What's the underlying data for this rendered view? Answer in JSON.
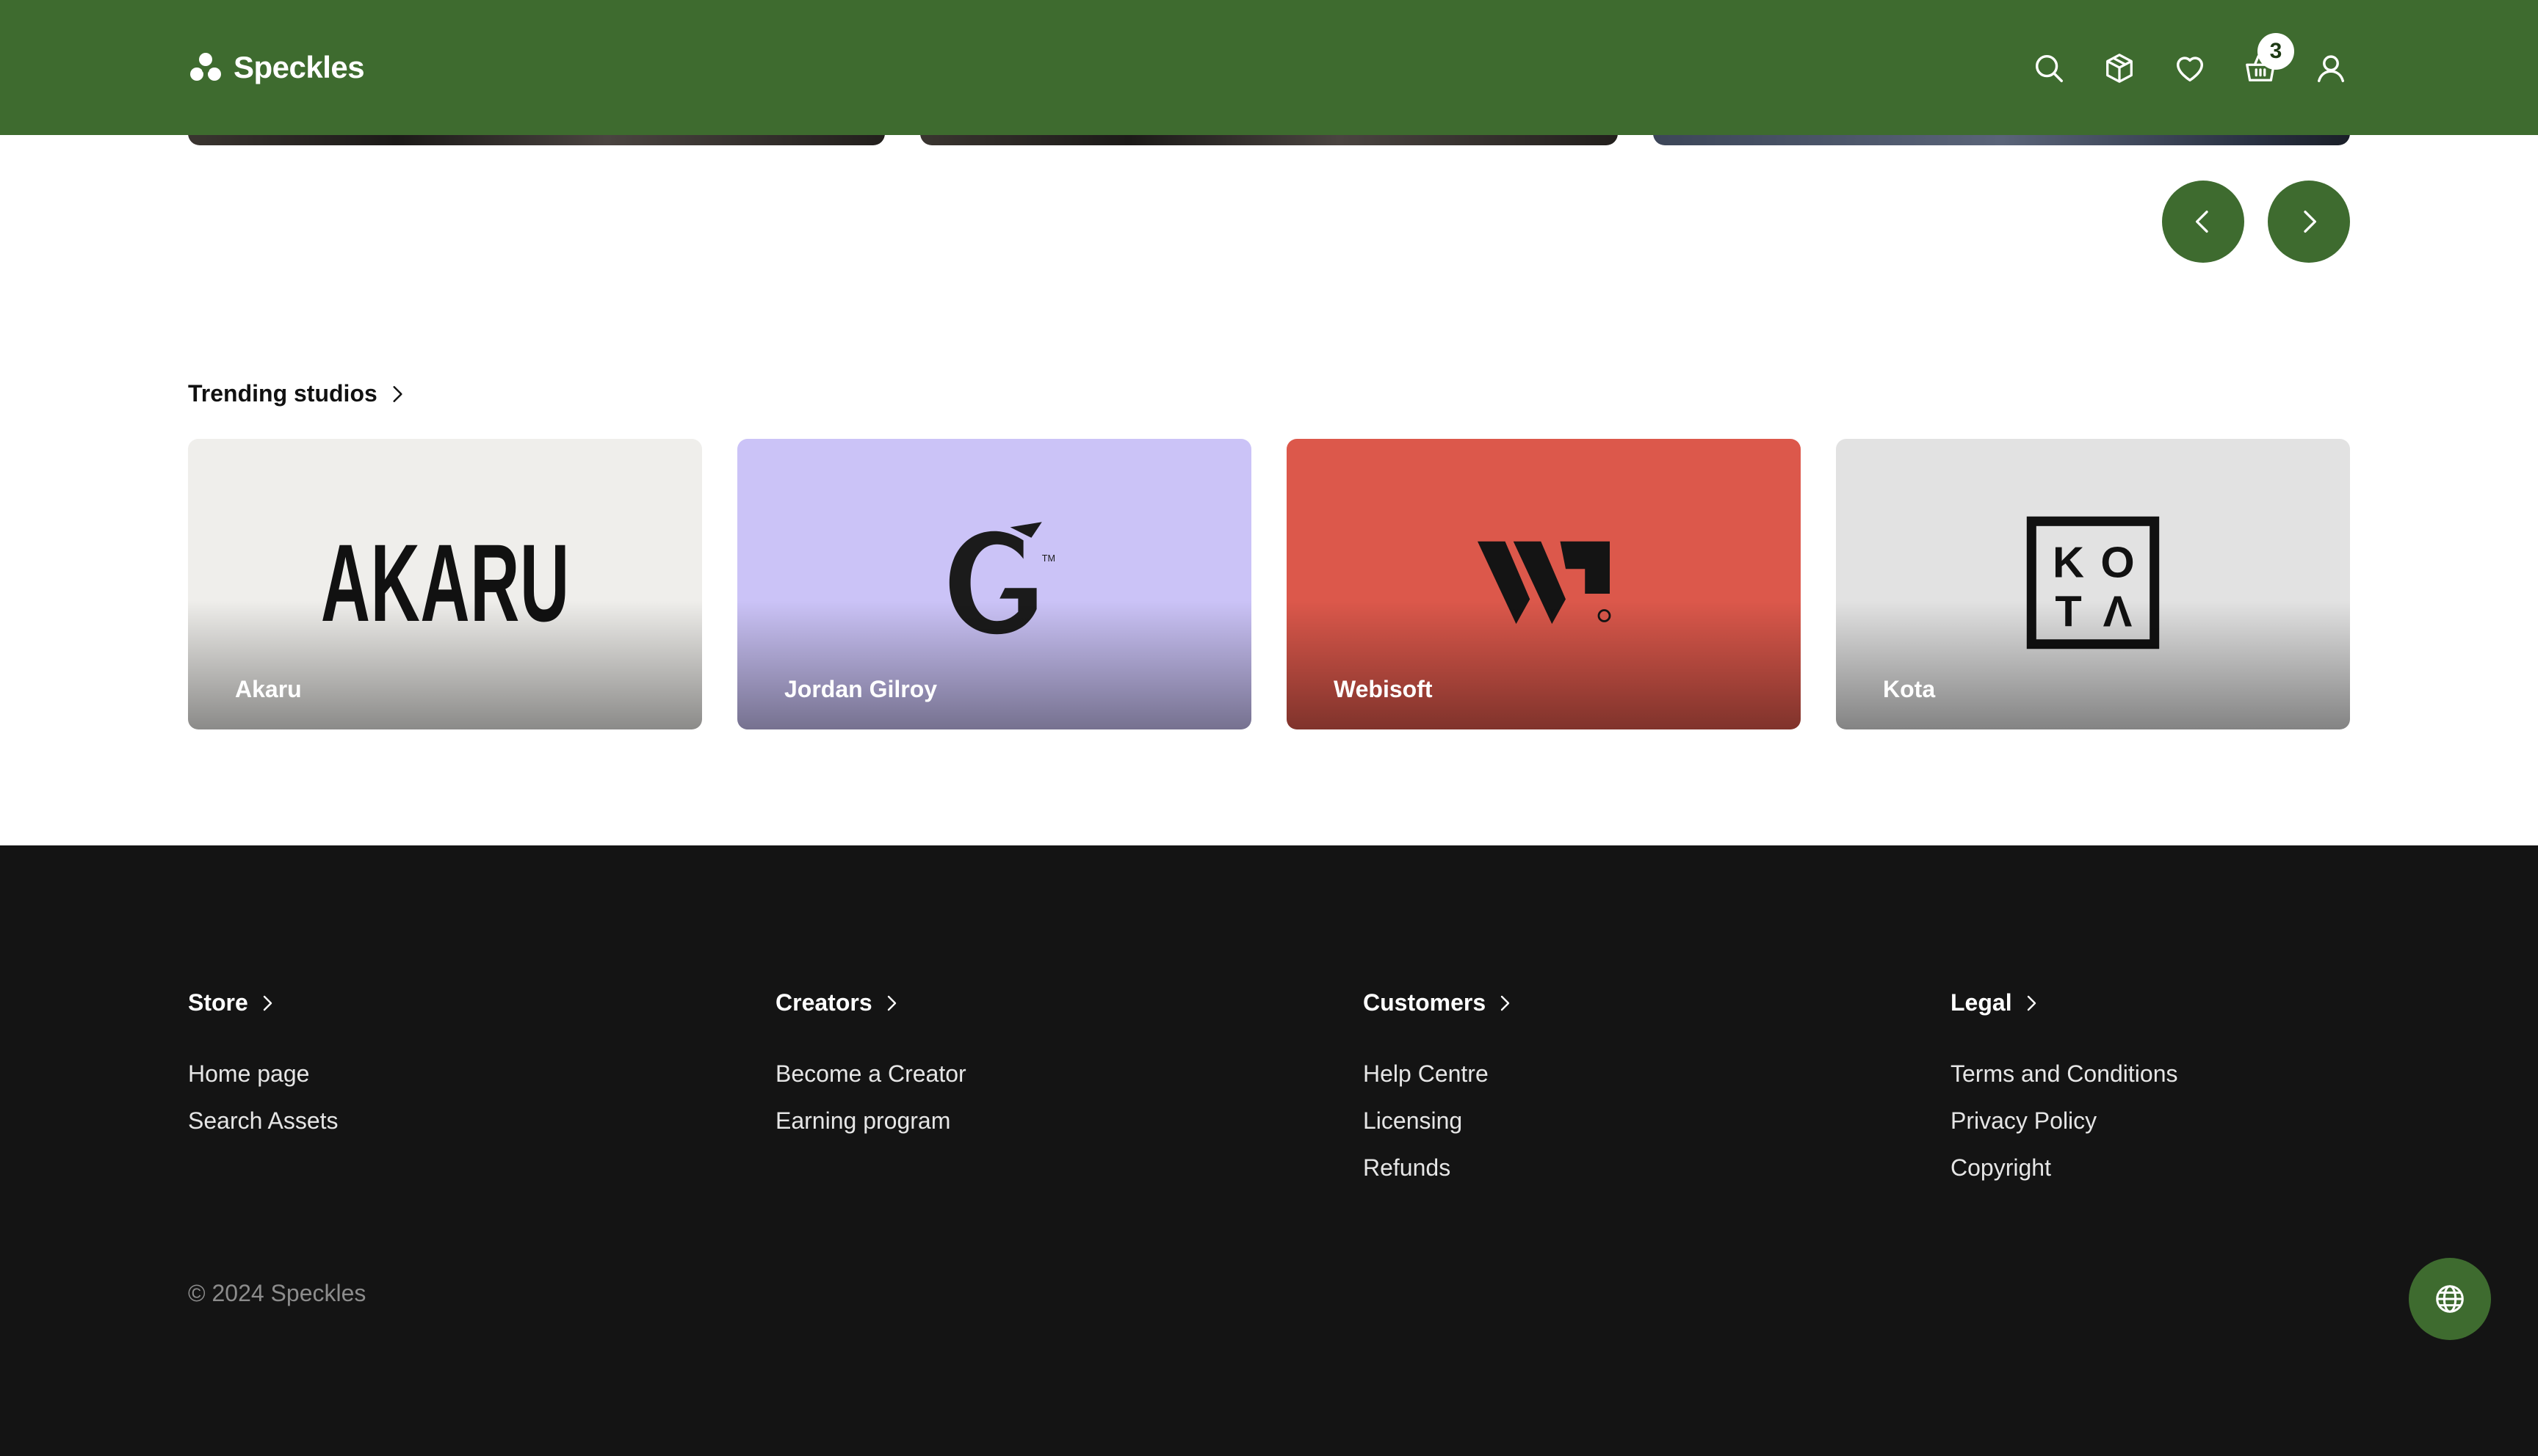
{
  "brand": {
    "name": "Speckles"
  },
  "header": {
    "icons": [
      "search-icon",
      "box-icon",
      "heart-icon",
      "basket-icon",
      "user-icon"
    ],
    "cart_count": "3"
  },
  "trending": {
    "title": "Trending studios",
    "studios": [
      {
        "name": "Akaru",
        "logo_text": "AKARU",
        "bg": "#efeeeb"
      },
      {
        "name": "Jordan Gilroy",
        "logo_text": "G",
        "bg": "#cbc3f7"
      },
      {
        "name": "Webisoft",
        "logo_text": "W",
        "bg": "#dc584b"
      },
      {
        "name": "Kota",
        "logo_text": [
          "K",
          "O",
          "T",
          "Λ"
        ],
        "bg": "#e2e2e2"
      }
    ]
  },
  "footer": {
    "columns": [
      {
        "title": "Store",
        "links": [
          "Home page",
          "Search Assets"
        ]
      },
      {
        "title": "Creators",
        "links": [
          "Become a Creator",
          "Earning program"
        ]
      },
      {
        "title": "Customers",
        "links": [
          "Help Centre",
          "Licensing",
          "Refunds"
        ]
      },
      {
        "title": "Legal",
        "links": [
          "Terms and Conditions",
          "Privacy Policy",
          "Copyright"
        ]
      }
    ],
    "copyright": "© 2024 Speckles"
  },
  "colors": {
    "header_green": "#3e6b2f",
    "footer_bg": "#141414",
    "white": "#ffffff"
  }
}
